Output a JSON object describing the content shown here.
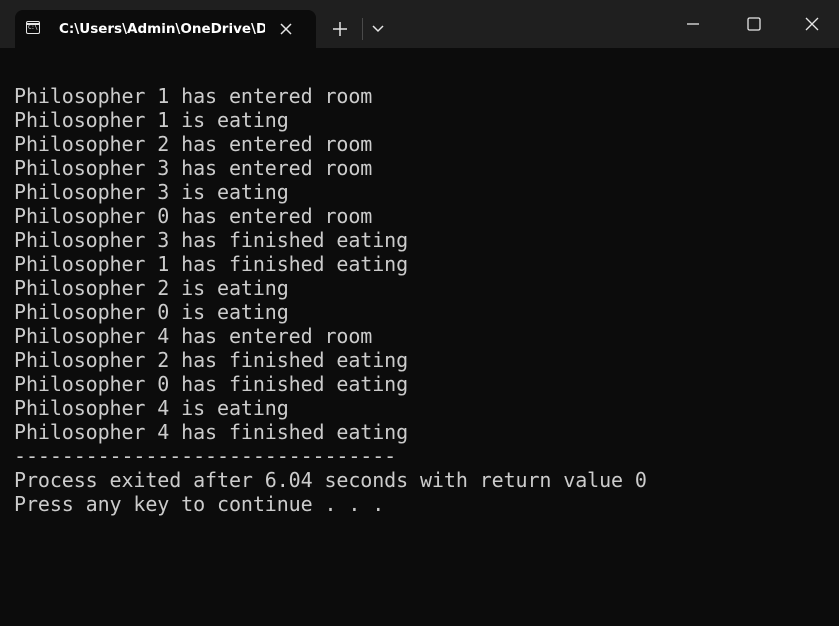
{
  "window": {
    "tab_title": "C:\\Users\\Admin\\OneDrive\\Do",
    "tab_icon": "cmd-icon",
    "controls": {
      "new_tab_icon": "plus-icon",
      "dropdown_icon": "chevron-down-icon",
      "minimize_icon": "minimize-icon",
      "maximize_icon": "maximize-icon",
      "close_icon": "close-icon"
    }
  },
  "console": {
    "lines": [
      "Philosopher 1 has entered room",
      "Philosopher 1 is eating",
      "Philosopher 2 has entered room",
      "Philosopher 3 has entered room",
      "Philosopher 3 is eating",
      "Philosopher 0 has entered room",
      "Philosopher 3 has finished eating",
      "Philosopher 1 has finished eating",
      "Philosopher 2 is eating",
      "Philosopher 0 is eating",
      "Philosopher 4 has entered room",
      "Philosopher 2 has finished eating",
      "Philosopher 0 has finished eating",
      "Philosopher 4 is eating",
      "Philosopher 4 has finished eating",
      "--------------------------------",
      "Process exited after 6.04 seconds with return value 0",
      "Press any key to continue . . ."
    ]
  },
  "colors": {
    "background": "#0c0c0c",
    "titlebar": "#1f1f1f",
    "text": "#cccccc"
  }
}
